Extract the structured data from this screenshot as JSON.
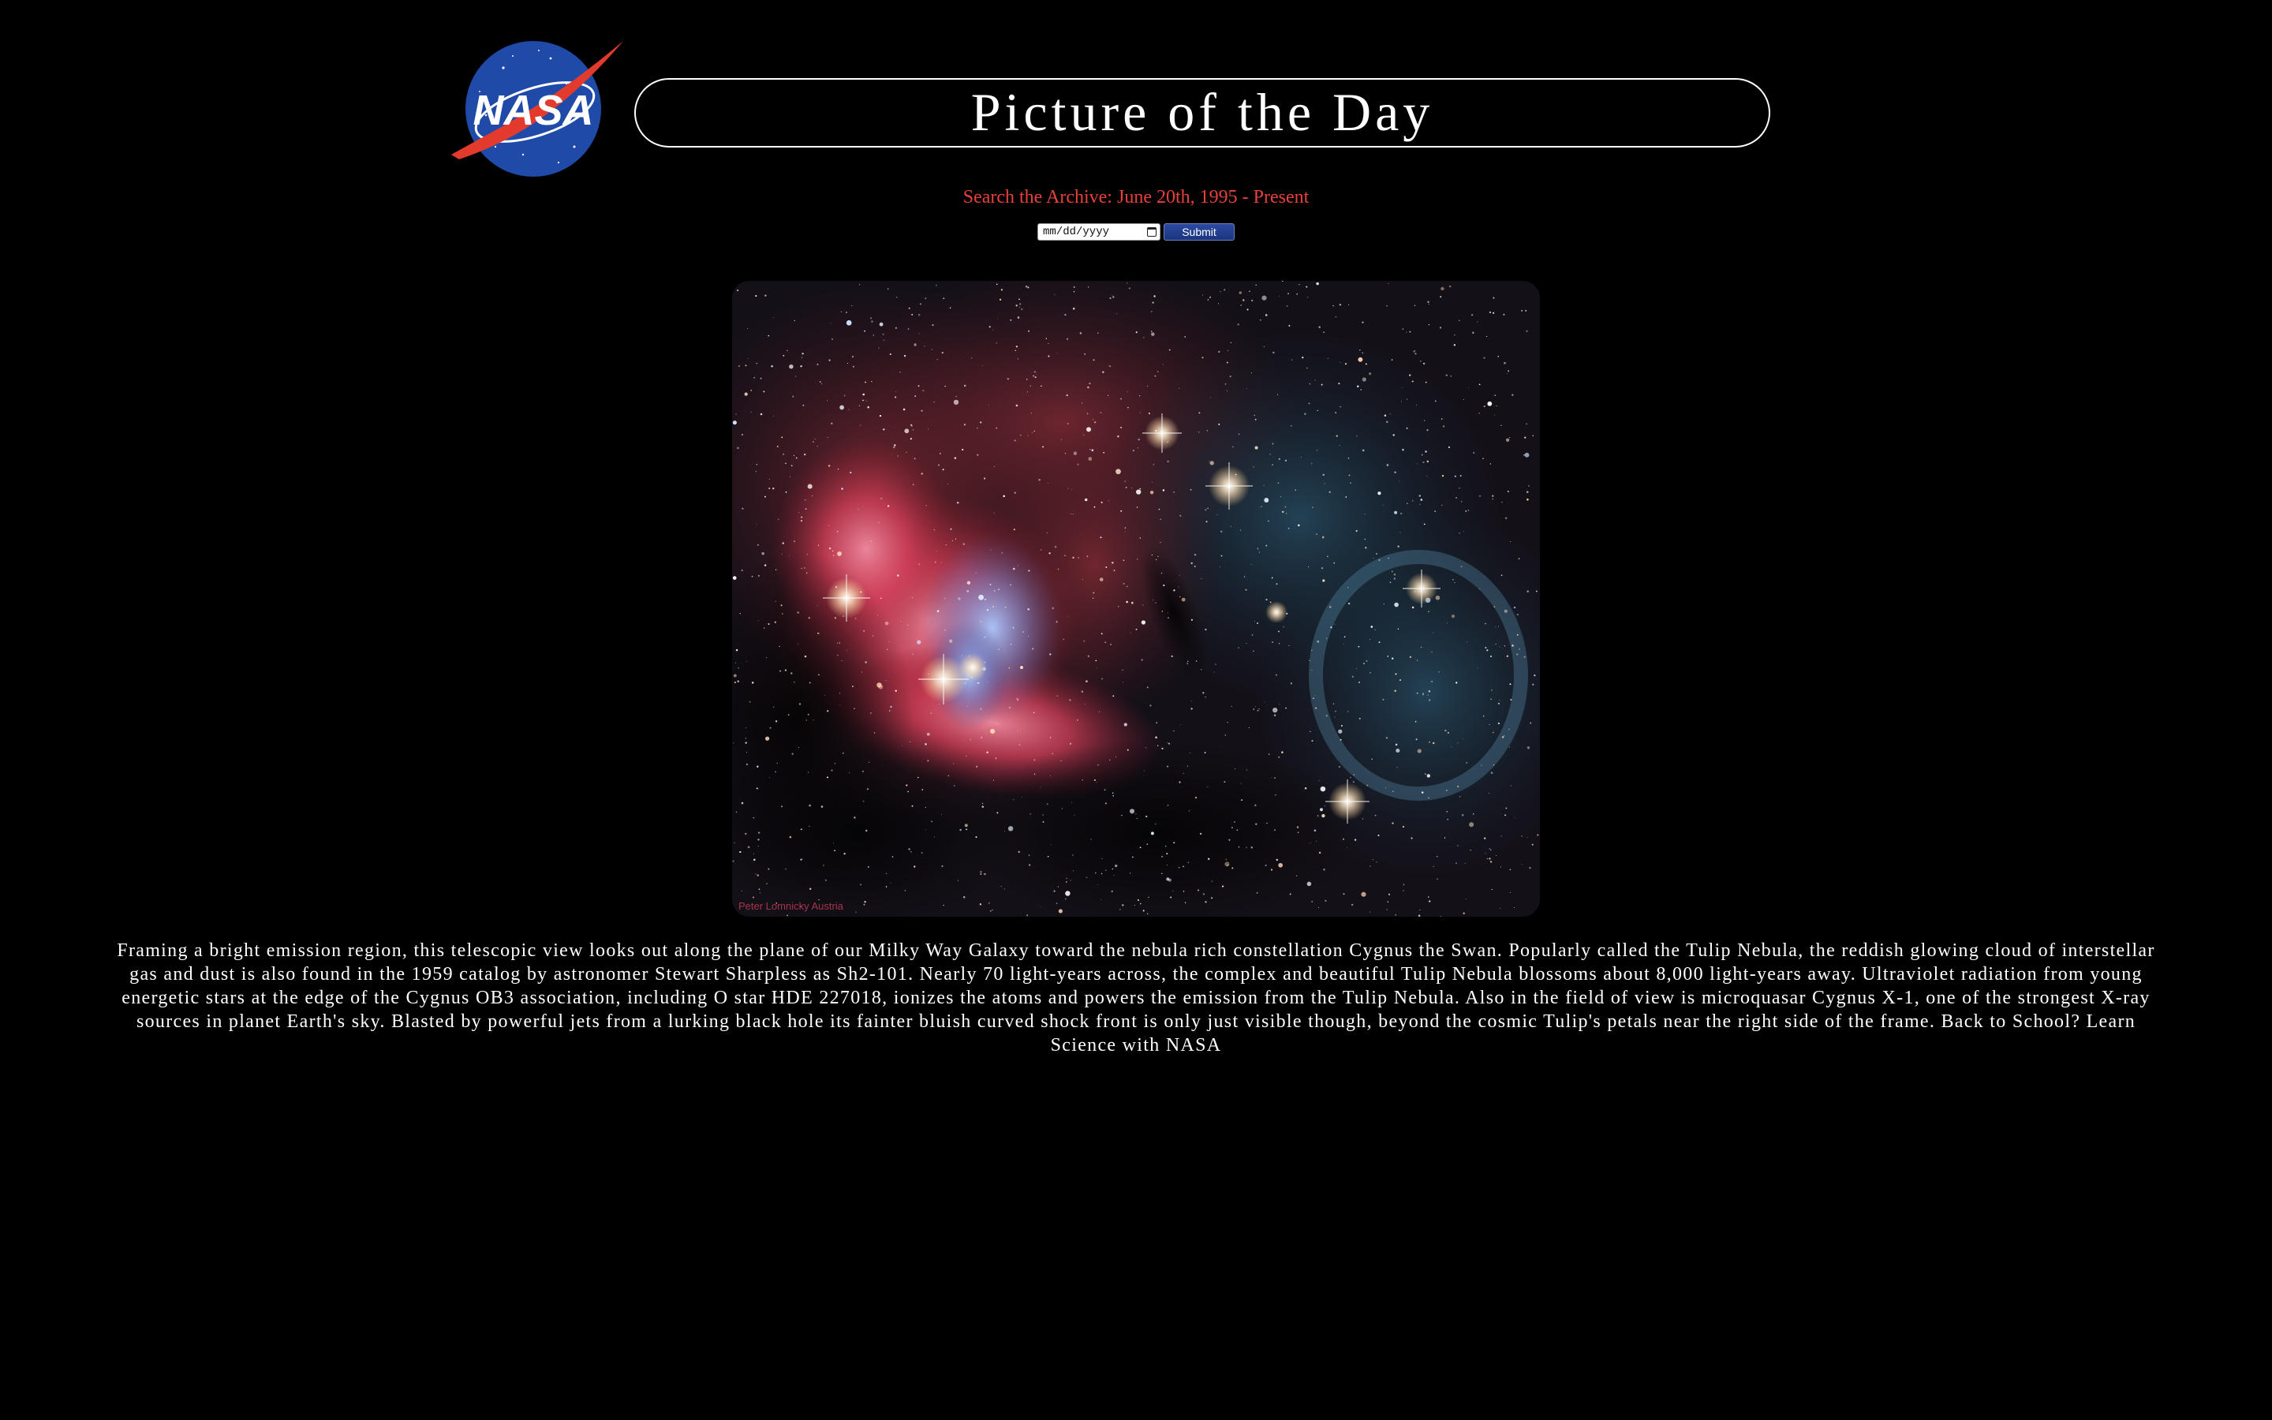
{
  "header": {
    "logo_text": "NASA",
    "title": "Picture of the Day"
  },
  "archive": {
    "label": "Search the Archive: June 20th, 1995 - Present",
    "date_placeholder": "mm/dd/yyyy",
    "submit_label": "Submit"
  },
  "picture": {
    "credit": "Peter Lomnicky Austria",
    "explanation": "Framing a bright emission region, this telescopic view looks out along the plane of our Milky Way Galaxy toward the nebula rich constellation Cygnus the Swan. Popularly called the Tulip Nebula, the reddish glowing cloud of interstellar gas and dust is also found in the 1959 catalog by astronomer Stewart Sharpless as Sh2-101. Nearly 70 light-years across, the complex and beautiful Tulip Nebula blossoms about 8,000 light-years away. Ultraviolet radiation from young energetic stars at the edge of the Cygnus OB3 association, including O star HDE 227018, ionizes the atoms and powers the emission from the Tulip Nebula. Also in the field of view is microquasar Cygnus X-1, one of the strongest X-ray sources in planet Earth's sky. Blasted by powerful jets from a lurking black hole its fainter bluish curved shock front is only just visible though, beyond the cosmic Tulip's petals near the right side of the frame. Back to School? Learn Science with NASA"
  },
  "colors": {
    "background": "#000000",
    "archive_text": "#e8413c",
    "button": "#1f3a8a",
    "logo_blue": "#1f4aa8",
    "logo_red": "#e23b2e"
  },
  "icons": {
    "calendar": "calendar-icon",
    "logo": "nasa-meatball-logo"
  }
}
